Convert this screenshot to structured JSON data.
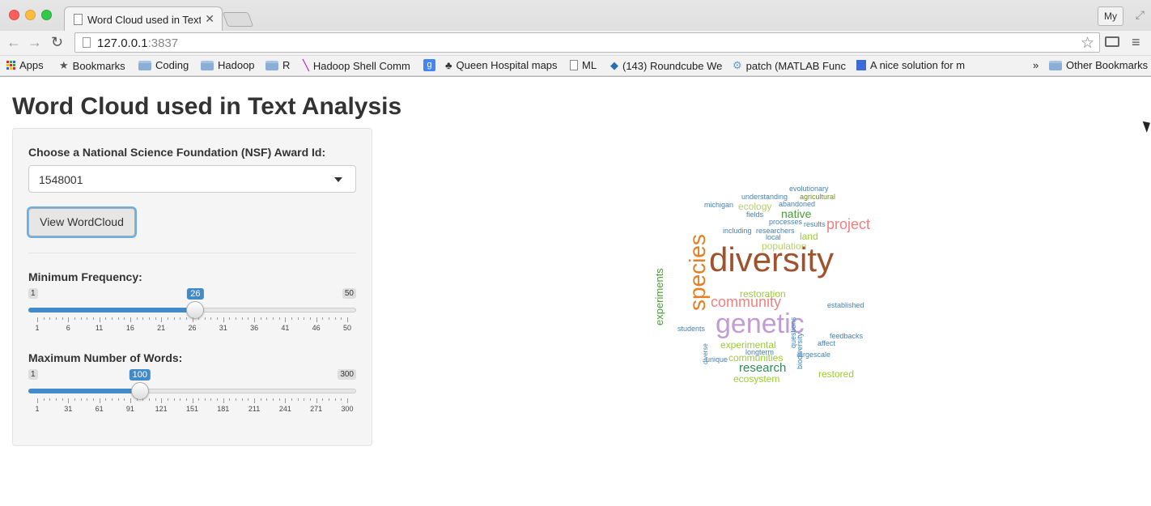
{
  "browser": {
    "tab_title": "Word Cloud used in Text A",
    "profile_label": "My",
    "url_host": "127.0.0.1",
    "url_port": ":3837",
    "bookmarks": [
      {
        "label": "Apps",
        "icon": "apps-icon"
      },
      {
        "label": "Bookmarks",
        "icon": "star-icon"
      },
      {
        "label": "Coding",
        "icon": "folder-icon"
      },
      {
        "label": "Hadoop",
        "icon": "folder-icon"
      },
      {
        "label": "R",
        "icon": "folder-icon"
      },
      {
        "label": "Hadoop Shell Comm",
        "icon": "bookmark-icon"
      },
      {
        "label": "",
        "icon": "google-icon"
      },
      {
        "label": "Queen Hospital maps",
        "icon": "tree-icon"
      },
      {
        "label": "ML",
        "icon": "page-icon"
      },
      {
        "label": "(143) Roundcube We",
        "icon": "roundcube-icon"
      },
      {
        "label": "patch (MATLAB Func",
        "icon": "matlab-icon"
      },
      {
        "label": "A nice solution for m",
        "icon": "bookmark-icon"
      }
    ],
    "overflow_label": "»",
    "other_bookmarks_label": "Other Bookmarks"
  },
  "app": {
    "title": "Word Cloud used in Text Analysis",
    "award_select": {
      "label": "Choose a National Science Foundation (NSF) Award Id:",
      "value": "1548001"
    },
    "view_button_label": "View WordCloud",
    "min_freq": {
      "label": "Minimum Frequency:",
      "min": 1,
      "max": 50,
      "value": 26,
      "min_label": "1",
      "max_label": "50",
      "value_label": "26",
      "tick_labels": [
        "1",
        "6",
        "11",
        "16",
        "21",
        "26",
        "31",
        "36",
        "41",
        "46",
        "50"
      ]
    },
    "max_words": {
      "label": "Maximum Number of Words:",
      "min": 1,
      "max": 300,
      "value": 100,
      "min_label": "1",
      "max_label": "300",
      "value_label": "100",
      "tick_labels": [
        "1",
        "31",
        "61",
        "91",
        "121",
        "151",
        "181",
        "211",
        "241",
        "271",
        "300"
      ]
    }
  },
  "wordcloud": [
    {
      "word": "diversity",
      "color": "#a0522d"
    },
    {
      "word": "genetic",
      "color": "#c39bd3"
    },
    {
      "word": "species",
      "color": "#e67e22"
    },
    {
      "word": "community",
      "color": "#f08080"
    },
    {
      "word": "project",
      "color": "#f08080"
    },
    {
      "word": "research",
      "color": "#2e8b57"
    },
    {
      "word": "native",
      "color": "#4a9a3a"
    },
    {
      "word": "experiments",
      "color": "#4a9a3a"
    },
    {
      "word": "restoration",
      "color": "#9acd32"
    },
    {
      "word": "experimental",
      "color": "#9acd32"
    },
    {
      "word": "communities",
      "color": "#9acd32"
    },
    {
      "word": "ecosystem",
      "color": "#9acd32"
    },
    {
      "word": "restored",
      "color": "#9acd32"
    },
    {
      "word": "population",
      "color": "#b5cf6b"
    },
    {
      "word": "ecology",
      "color": "#b5cf6b"
    },
    {
      "word": "land",
      "color": "#9acd32"
    },
    {
      "word": "evolutionary",
      "color": "#4682b4"
    },
    {
      "word": "understanding",
      "color": "#4682b4"
    },
    {
      "word": "agricultural",
      "color": "#6b8e23"
    },
    {
      "word": "michigan",
      "color": "#4682b4"
    },
    {
      "word": "abandoned",
      "color": "#4682b4"
    },
    {
      "word": "fields",
      "color": "#4682b4"
    },
    {
      "word": "processes",
      "color": "#4682b4"
    },
    {
      "word": "results",
      "color": "#4682b4"
    },
    {
      "word": "including",
      "color": "#4682b4"
    },
    {
      "word": "researchers",
      "color": "#4682b4"
    },
    {
      "word": "local",
      "color": "#4682b4"
    },
    {
      "word": "established",
      "color": "#4682b4"
    },
    {
      "word": "students",
      "color": "#4682b4"
    },
    {
      "word": "questions",
      "color": "#4682b4"
    },
    {
      "word": "biodiversity",
      "color": "#4682b4"
    },
    {
      "word": "feedbacks",
      "color": "#4682b4"
    },
    {
      "word": "affect",
      "color": "#4682b4"
    },
    {
      "word": "longterm",
      "color": "#4682b4"
    },
    {
      "word": "largescale",
      "color": "#4682b4"
    },
    {
      "word": "unique",
      "color": "#4682b4"
    },
    {
      "word": "diverse",
      "color": "#4682b4"
    }
  ]
}
